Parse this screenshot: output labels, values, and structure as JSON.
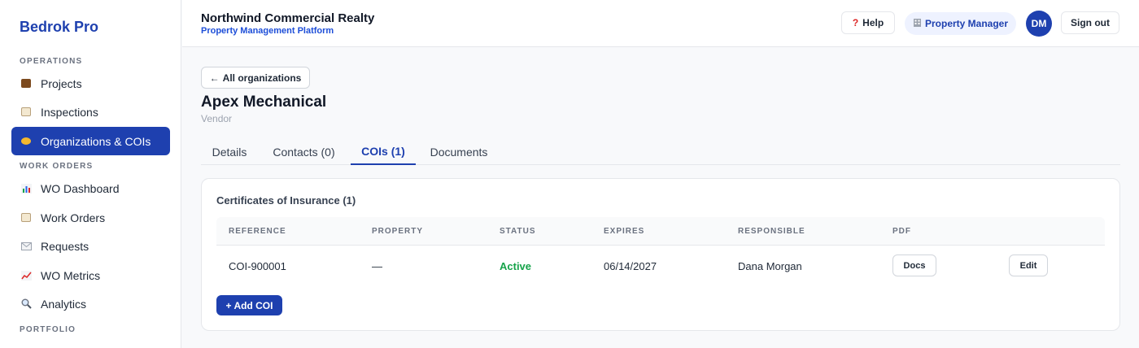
{
  "sidebar": {
    "brand": "Bedrok Pro",
    "sections": [
      {
        "title": "OPERATIONS",
        "items": [
          {
            "label": "Projects",
            "icon": "briefcase-icon"
          },
          {
            "label": "Inspections",
            "icon": "clipboard-icon"
          },
          {
            "label": "Organizations & COIs",
            "icon": "handshake-icon",
            "active": true
          }
        ]
      },
      {
        "title": "WORK ORDERS",
        "items": [
          {
            "label": "WO Dashboard",
            "icon": "bar-chart-icon"
          },
          {
            "label": "Work Orders",
            "icon": "clipboard-icon"
          },
          {
            "label": "Requests",
            "icon": "envelope-icon"
          },
          {
            "label": "WO Metrics",
            "icon": "line-chart-icon"
          },
          {
            "label": "Analytics",
            "icon": "magnifier-icon"
          }
        ]
      },
      {
        "title": "PORTFOLIO",
        "items": []
      }
    ]
  },
  "header": {
    "org_name": "Northwind Commercial Realty",
    "platform": "Property Management Platform",
    "help_label": "Help",
    "role_label": "Property Manager",
    "avatar_initials": "DM",
    "signout_label": "Sign out"
  },
  "main": {
    "back_label": "All organizations",
    "title": "Apex Mechanical",
    "subtitle": "Vendor",
    "tabs": [
      {
        "label": "Details"
      },
      {
        "label": "Contacts (0)"
      },
      {
        "label": "COIs (1)",
        "active": true
      },
      {
        "label": "Documents"
      }
    ],
    "card": {
      "title": "Certificates of Insurance (1)",
      "columns": [
        "REFERENCE",
        "PROPERTY",
        "STATUS",
        "EXPIRES",
        "RESPONSIBLE",
        "PDF"
      ],
      "rows": [
        {
          "reference": "COI-900001",
          "property": "—",
          "status": "Active",
          "expires": "06/14/2027",
          "responsible": "Dana Morgan",
          "pdf_button": "Docs",
          "edit_button": "Edit"
        }
      ],
      "add_button": "+ Add COI"
    }
  },
  "colors": {
    "brand": "#1e40af",
    "active_status": "#16a34a"
  }
}
